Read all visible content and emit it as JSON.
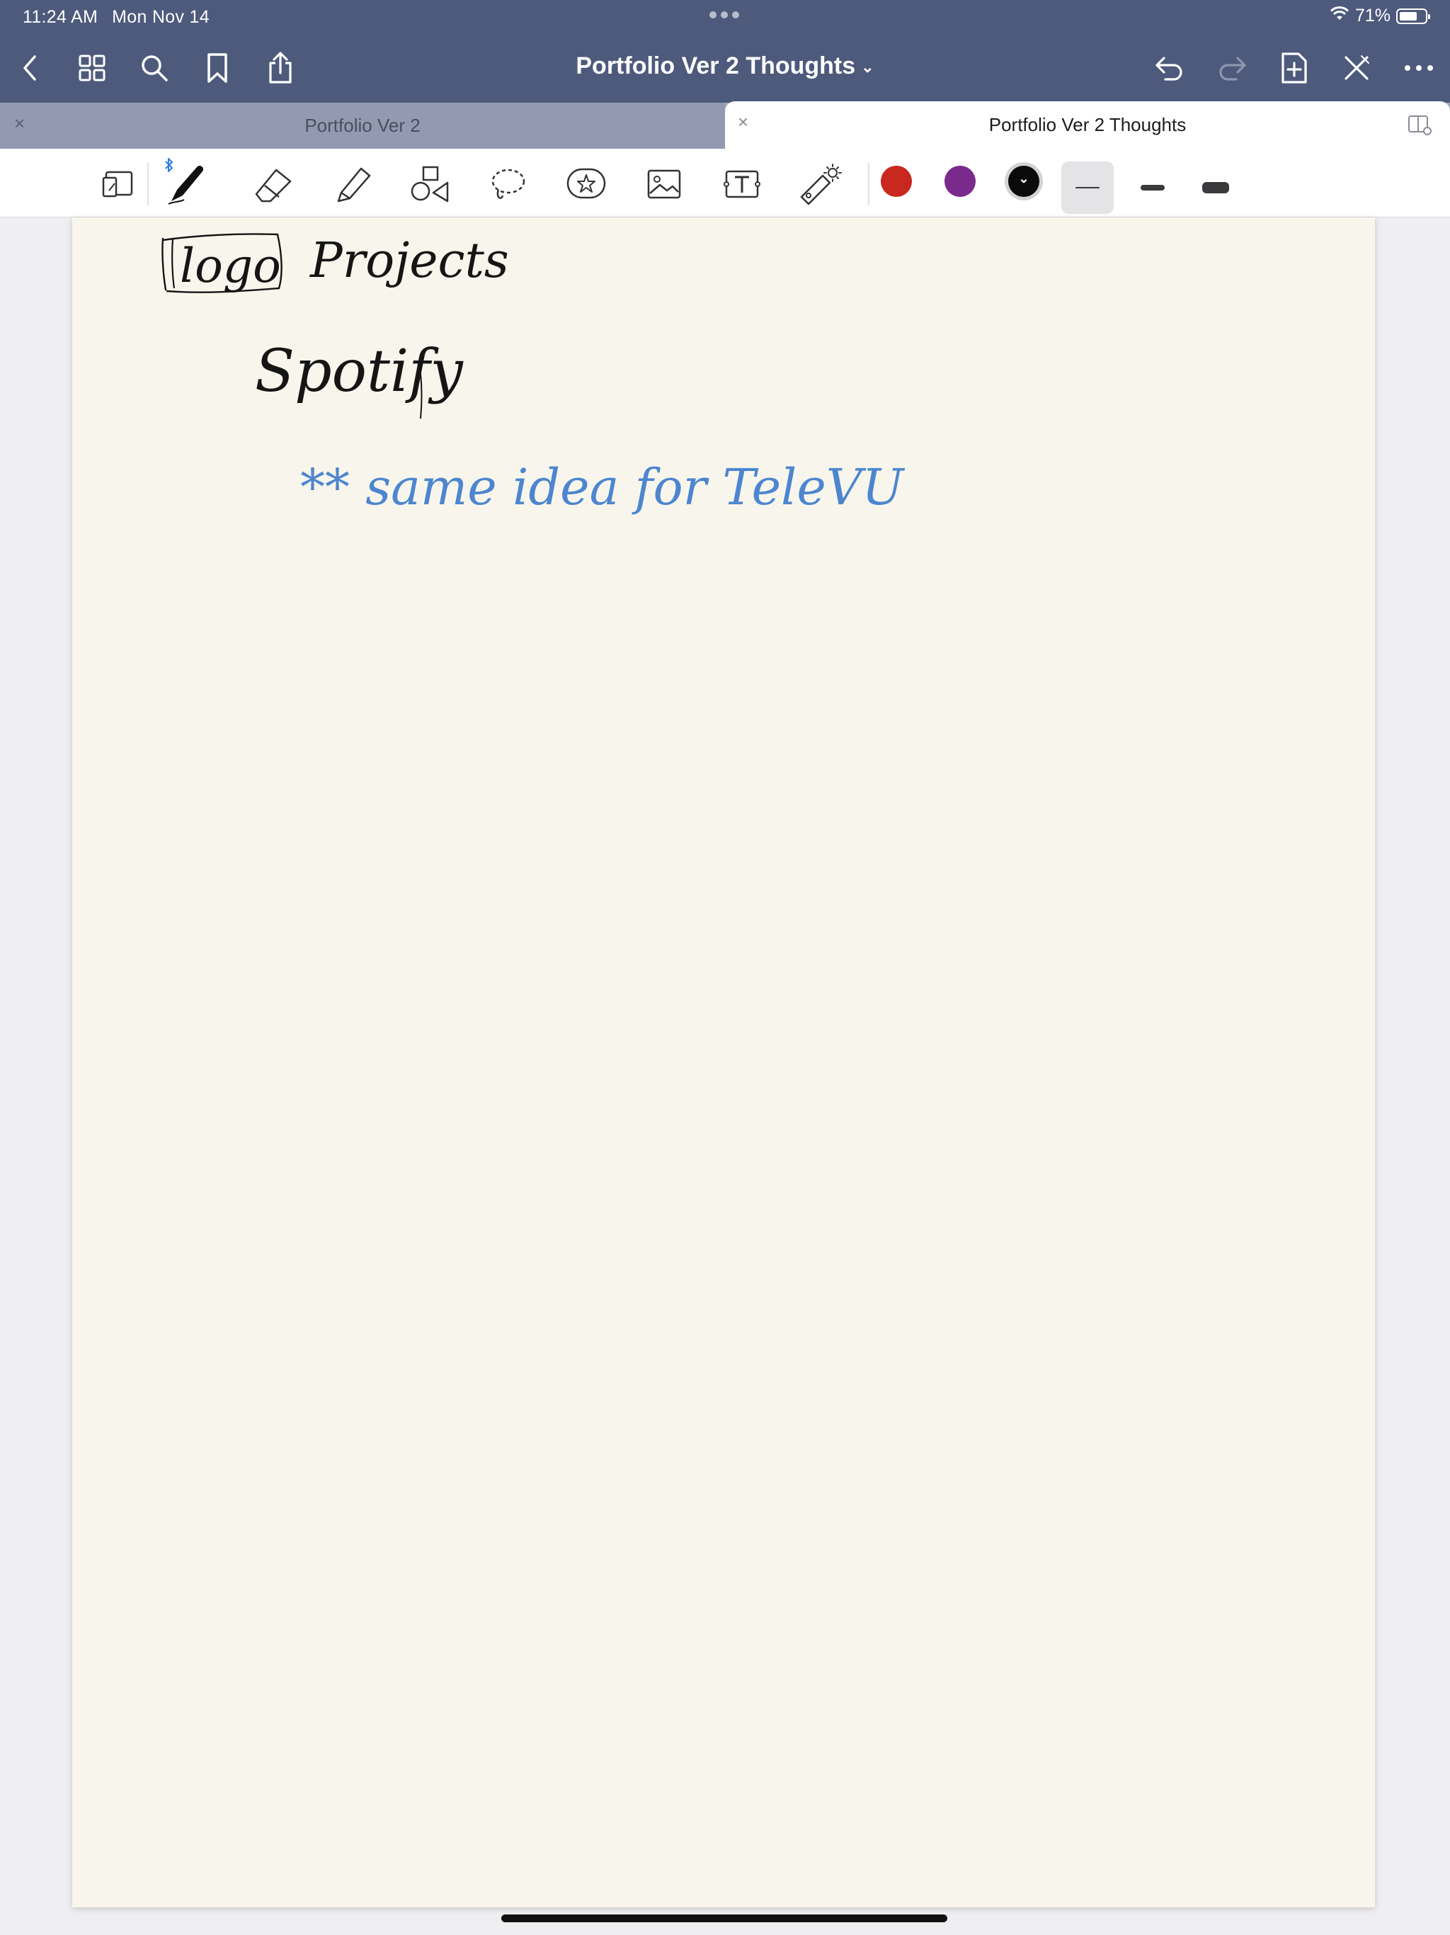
{
  "status_bar": {
    "time": "11:24 AM",
    "date": "Mon Nov 14",
    "battery_text": "71%",
    "battery_level": 0.71,
    "wifi_icon": "wifi-icon"
  },
  "nav": {
    "title": "Portfolio Ver 2 Thoughts",
    "title_chevron": "⌄",
    "left_icons": [
      "back-icon",
      "grid-icon",
      "search-icon",
      "bookmark-icon",
      "share-icon"
    ],
    "right_icons": [
      "undo-icon",
      "redo-icon",
      "add-page-icon",
      "close-pen-icon",
      "more-icon"
    ]
  },
  "tabs": [
    {
      "label": "Portfolio Ver 2",
      "close": "×",
      "active": false
    },
    {
      "label": "Portfolio Ver 2 Thoughts",
      "close": "×",
      "active": true
    }
  ],
  "toolbar": {
    "tools": [
      "zoom-window-icon",
      "pen-icon",
      "eraser-icon",
      "highlighter-icon",
      "shapes-icon",
      "lasso-icon",
      "sticker-icon",
      "image-icon",
      "text-icon",
      "laser-pointer-icon"
    ],
    "active_tool": "pen-icon",
    "bluetooth_icon": "bluetooth-icon",
    "colors": [
      "#c8281e",
      "#7a2a8c",
      "#0b0b0b"
    ],
    "selected_color": "#0b0b0b",
    "color_chevron": "⌄",
    "stroke_widths": [
      "thin",
      "medium",
      "thick"
    ],
    "selected_stroke": "thin"
  },
  "page": {
    "background": "#f8f6ec",
    "handwriting": [
      {
        "text": "logo",
        "color": "black"
      },
      {
        "text": "Projects",
        "color": "black"
      },
      {
        "text": "Spotify",
        "color": "black"
      },
      {
        "text": "** same idea for TeleVU",
        "color": "blue"
      }
    ]
  }
}
